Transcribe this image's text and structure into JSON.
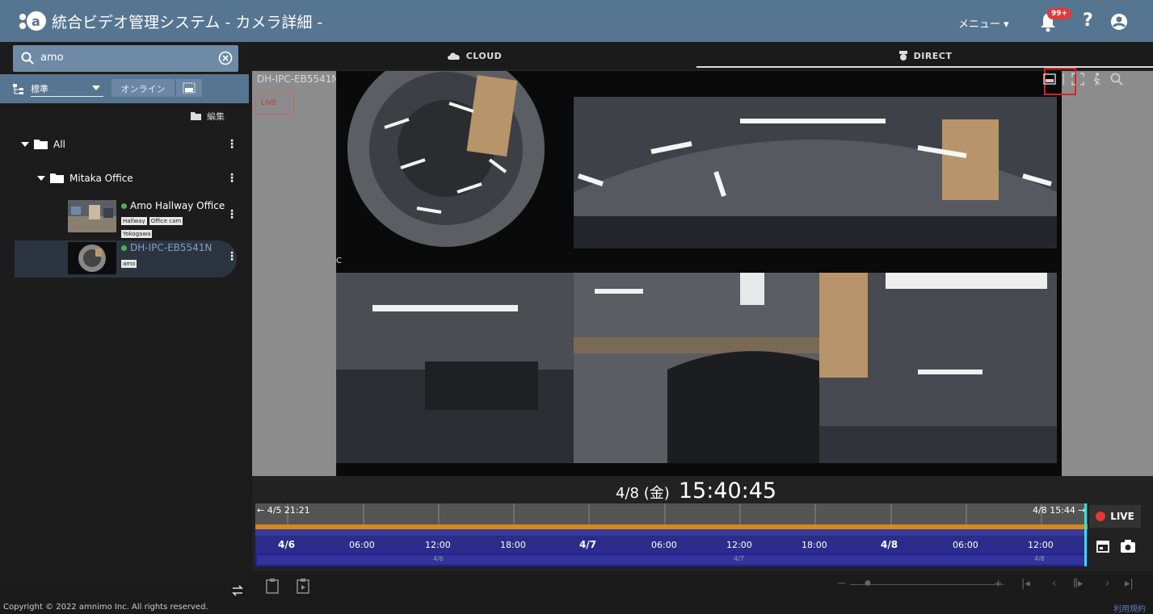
{
  "header": {
    "title": "統合ビデオ管理システム  - カメラ詳細 -",
    "menu_label": "メニュー ▾",
    "notification_badge": "99+",
    "help_label": "?"
  },
  "sidebar": {
    "search_value": "amo",
    "filter_select": "標準",
    "online_button": "オンライン",
    "edit_label": "編集",
    "tree": {
      "root": "All",
      "folder": "Mitaka Office",
      "cameras": [
        {
          "name": "Amo Hallway Office",
          "tags": [
            "Hallway",
            "Office cam",
            "Yokogawa"
          ],
          "status": "online"
        },
        {
          "name": "DH-IPC-EB5541N",
          "tags": [
            "amo"
          ],
          "status": "online"
        }
      ]
    }
  },
  "tabs": {
    "cloud": "CLOUD",
    "direct": "DIRECT"
  },
  "viewer": {
    "camera_label": "DH-IPC-EB5541N",
    "live_tag": "LIVE",
    "corner_label": "C"
  },
  "playback": {
    "date": "4/8 (金)",
    "time": "15:40:45",
    "range_start": "← 4/5 21:21",
    "range_end": "4/8 15:44 →",
    "axis_labels": [
      "4/6",
      "06:00",
      "12:00",
      "18:00",
      "4/7",
      "06:00",
      "12:00",
      "18:00",
      "4/8",
      "06:00",
      "12:00"
    ],
    "day_labels": [
      "4/6",
      "4/7",
      "4/8"
    ],
    "live_button": "LIVE"
  },
  "footer": {
    "copyright": "Copyright © 2022 amnimo Inc. All rights reserved.",
    "terms": "利用規約"
  },
  "colors": {
    "header_bg": "#567591",
    "timeline_orange": "#d4891c",
    "timeline_blue": "#2c2c8a",
    "cursor": "#2ee0e0",
    "live_red": "#e53935",
    "online_green": "#4caf50"
  }
}
